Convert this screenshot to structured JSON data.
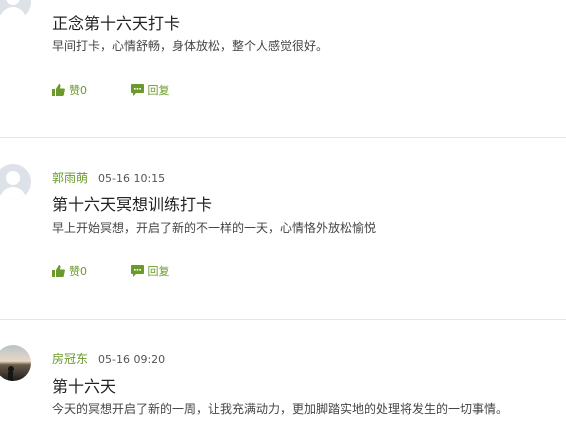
{
  "posts": [
    {
      "title": "正念第十六天打卡",
      "content": "早间打卡，心情舒畅，身体放松，整个人感觉很好。",
      "likes": "赞0",
      "reply": "回复"
    },
    {
      "user": "郭雨萌",
      "time": "05-16 10:15",
      "title": "第十六天冥想训练打卡",
      "content": "早上开始冥想，开启了新的不一样的一天，心情恪外放松愉悦",
      "likes": "赞0",
      "reply": "回复"
    },
    {
      "user": "房冠东",
      "time": "05-16 09:20",
      "title": "第十六天",
      "content": "今天的冥想开启了新的一周，让我充满动力，更加脚踏实地的处理将发生的一切事情。"
    }
  ],
  "colors": {
    "accent": "#6a9a2a",
    "divider": "#e6e6e6"
  },
  "icons": {
    "like": "thumbs-up-icon",
    "reply": "comment-icon"
  }
}
